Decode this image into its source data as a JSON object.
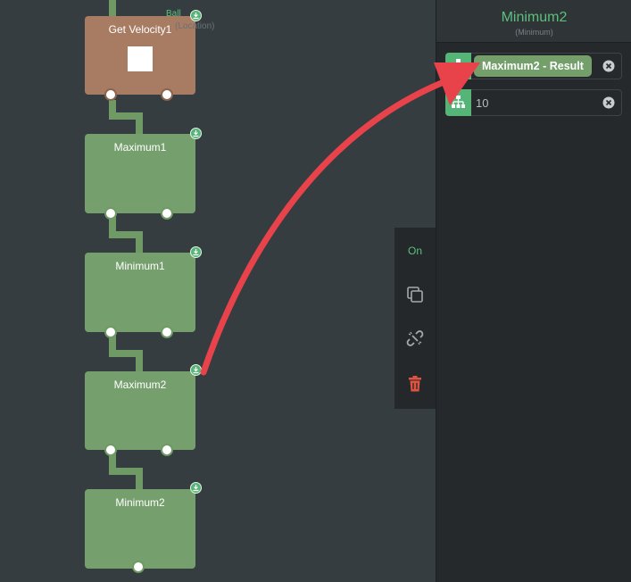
{
  "canvas": {
    "nodes": [
      {
        "title": "Get Velocity1",
        "ghost_top": "Ball",
        "ghost_bottom": "(Location)"
      },
      {
        "title": "Maximum1"
      },
      {
        "title": "Minimum1"
      },
      {
        "title": "Maximum2"
      },
      {
        "title": "Minimum2"
      }
    ]
  },
  "toolbar": {
    "on_label": "On",
    "icons": [
      "duplicate-icon",
      "unlink-icon",
      "trash-icon"
    ],
    "trash_color": "#e2533f"
  },
  "panel": {
    "title": "Minimum2",
    "subtitle": "(Minimum)",
    "inputs": [
      {
        "value": "Maximum2 - Result",
        "kind": "link"
      },
      {
        "value": "10",
        "kind": "number"
      }
    ]
  },
  "colors": {
    "accent": "#5bc07d",
    "node_green": "#759f6c",
    "node_brown": "#a87c62",
    "annotation_arrow": "#e8424b"
  }
}
